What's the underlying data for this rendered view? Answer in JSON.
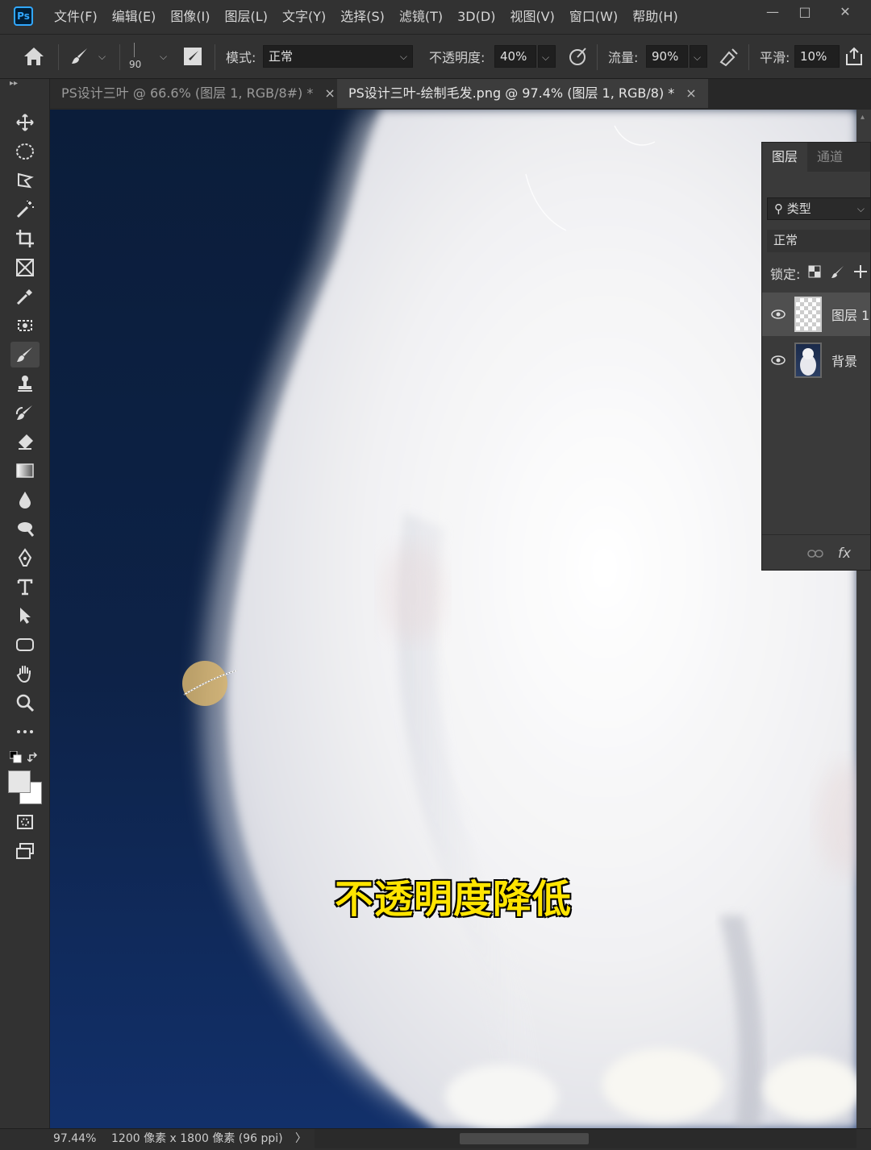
{
  "app": {
    "logo": "Ps"
  },
  "menu": [
    "文件(F)",
    "编辑(E)",
    "图像(I)",
    "图层(L)",
    "文字(Y)",
    "选择(S)",
    "滤镜(T)",
    "3D(D)",
    "视图(V)",
    "窗口(W)",
    "帮助(H)"
  ],
  "window_controls": {
    "minimize": "—",
    "maximize": "□",
    "close": "✕"
  },
  "options": {
    "brush_size": "90",
    "mode_label": "模式:",
    "mode_value": "正常",
    "opacity_label": "不透明度:",
    "opacity_value": "40%",
    "flow_label": "流量:",
    "flow_value": "90%",
    "smooth_label": "平滑:",
    "smooth_value": "10%"
  },
  "tabs": [
    {
      "title": "PS设计三叶 @ 66.6% (图层 1, RGB/8#) *",
      "active": false
    },
    {
      "title": "PS设计三叶-绘制毛发.png @ 97.4% (图层 1, RGB/8) *",
      "active": true
    }
  ],
  "tab_close": "×",
  "toolbar_collapse": "▸▸",
  "tools": [
    "move-icon",
    "ellipse-marquee-icon",
    "lasso-icon",
    "magic-wand-icon",
    "crop-icon",
    "frame-icon",
    "eyedropper-icon",
    "spot-heal-icon",
    "brush-icon",
    "clone-stamp-icon",
    "history-brush-icon",
    "eraser-icon",
    "gradient-icon",
    "blur-icon",
    "dodge-icon",
    "pen-icon",
    "type-icon",
    "path-select-icon",
    "rectangle-icon",
    "hand-icon",
    "zoom-icon",
    "more-icon"
  ],
  "selected_tool": "brush-icon",
  "subtitle": "不透明度降低",
  "layers_panel": {
    "tabs": [
      "图层",
      "通道"
    ],
    "filter": "类型",
    "blend_mode": "正常",
    "lock_label": "锁定:",
    "layers": [
      {
        "name": "图层 1",
        "visible": true,
        "selected": true
      },
      {
        "name": "背景",
        "visible": true,
        "selected": false
      }
    ],
    "footer_fx": "fx"
  },
  "status": {
    "zoom": "97.44%",
    "doc_info": "1200 像素 x 1800 像素 (96 ppi)",
    "arrow": "〉"
  },
  "colors": {
    "foreground": "#e6e6e6",
    "background": "#ffffff",
    "subtitle": "#ffe400",
    "ps_blue": "#31a8ff"
  }
}
